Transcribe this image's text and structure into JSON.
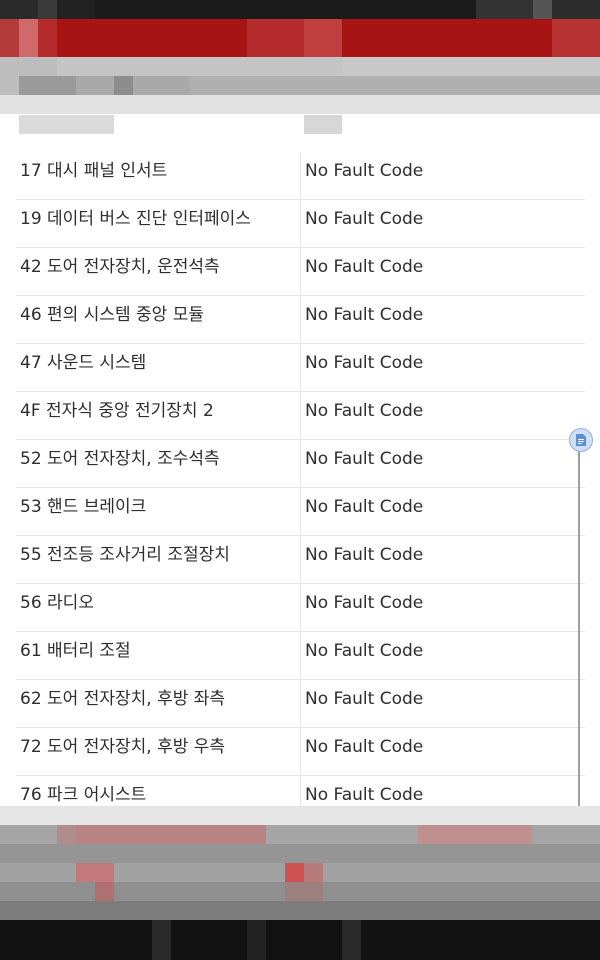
{
  "module_list": {
    "rows": [
      {
        "name": "17 대시 패널 인서트",
        "status": "No Fault Code"
      },
      {
        "name": "19 데이터 버스 진단 인터페이스",
        "status": "No Fault Code"
      },
      {
        "name": "42 도어 전자장치, 운전석측",
        "status": "No Fault Code"
      },
      {
        "name": "46 편의 시스템 중앙 모듈",
        "status": "No Fault Code"
      },
      {
        "name": "47 사운드 시스템",
        "status": "No Fault Code"
      },
      {
        "name": "4F 전자식 중앙 전기장치 2",
        "status": "No Fault Code"
      },
      {
        "name": "52 도어 전자장치, 조수석측",
        "status": "No Fault Code"
      },
      {
        "name": "53 핸드 브레이크",
        "status": "No Fault Code"
      },
      {
        "name": "55 전조등 조사거리 조절장치",
        "status": "No Fault Code"
      },
      {
        "name": "56 라디오",
        "status": "No Fault Code"
      },
      {
        "name": "61 배터리 조절",
        "status": "No Fault Code"
      },
      {
        "name": "62 도어 전자장치, 후방 좌측",
        "status": "No Fault Code"
      },
      {
        "name": "72 도어 전자장치, 후방 우측",
        "status": "No Fault Code"
      },
      {
        "name": "76 파크 어시스트",
        "status": "No Fault Code"
      }
    ]
  },
  "scrollbar": {
    "icon": "document-icon"
  },
  "colors": {
    "app_bar": "#a81414",
    "divider": "#e6e6e6",
    "text": "#2e2e2e",
    "scroll_thumb": "#cfe0f6"
  }
}
